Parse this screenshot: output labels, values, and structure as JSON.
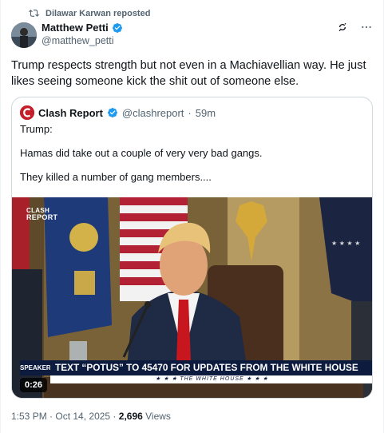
{
  "repost": {
    "text": "Dilawar Karwan reposted",
    "icon": "repost-icon"
  },
  "author": {
    "name": "Matthew Petti",
    "handle": "@matthew_petti",
    "verified": true,
    "badge_color": "#1d9bf0"
  },
  "actions": {
    "grok_icon": "grok-icon",
    "more_icon": "more-icon"
  },
  "tweet": {
    "text": "Trump respects strength but not even in a Machiavellian way. He just likes seeing someone kick the shit out of someone else."
  },
  "quote": {
    "name": "Clash Report",
    "handle": "@clashreport",
    "separator": "·",
    "time": "59m",
    "lines": [
      "Trump:",
      "Hamas did take out a couple of very very bad gangs.",
      "They killed a number of gang members...."
    ],
    "logo_color": "#c41e2a"
  },
  "media": {
    "watermark_line1": "CLASH",
    "watermark_line2": "REPORT",
    "chyron_main": "TEXT “POTUS” TO 45470 FOR UPDATES FROM THE WHITE HOUSE",
    "chyron_sub": "★ ★ ★  THE WHITE HOUSE  ★ ★ ★",
    "chyron_logo": "SPEAKER",
    "duration": "0:26"
  },
  "meta": {
    "time": "1:53 PM",
    "separator": " · ",
    "date": "Oct 14, 2025",
    "dot": " · ",
    "views_count": "2,696",
    "views_label": " Views"
  }
}
